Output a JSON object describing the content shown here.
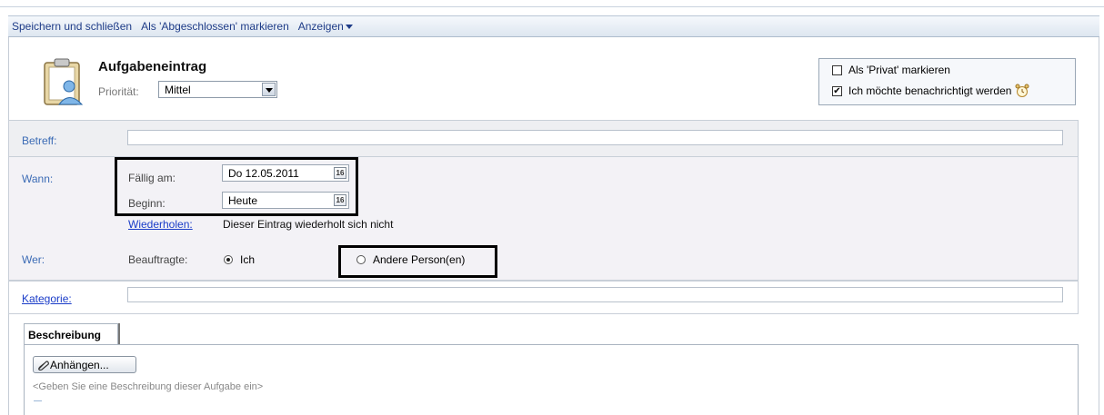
{
  "toolbar": {
    "save_close": "Speichern und schließen",
    "mark_done": "Als 'Abgeschlossen' markieren",
    "view": "Anzeigen"
  },
  "header": {
    "title": "Aufgabeneintrag",
    "priority_label": "Priorität:",
    "priority_value": "Mittel",
    "icon": "task-clipboard-icon"
  },
  "options": {
    "private_label": "Als 'Privat' markieren",
    "private_checked": false,
    "notify_label": "Ich möchte benachrichtigt werden",
    "notify_checked": true,
    "notify_icon": "alarm-clock-icon"
  },
  "betreff": {
    "label": "Betreff:",
    "value": ""
  },
  "wann": {
    "label": "Wann:",
    "due_label": "Fällig am:",
    "due_value": "Do 12.05.2011",
    "start_label": "Beginn:",
    "start_value": "Heute",
    "calendar_icon_text": "16",
    "repeat_link": "Wiederholen:",
    "repeat_value": "Dieser Eintrag wiederholt sich nicht"
  },
  "wer": {
    "label": "Wer:",
    "assignee_label": "Beauftragte:",
    "option_me": "Ich",
    "option_others": "Andere Person(en)",
    "selected": "Ich"
  },
  "kategorie": {
    "label": "Kategorie:",
    "value": ""
  },
  "description": {
    "tab_label": "Beschreibung",
    "attach_label": "Anhängen...",
    "attach_icon": "paperclip-icon",
    "placeholder": "<Geben Sie eine Beschreibung dieser Aufgabe ein>"
  },
  "colors": {
    "toolbar_text": "#1f3c88",
    "link": "#3b6bb5",
    "highlight_border": "#000000"
  }
}
